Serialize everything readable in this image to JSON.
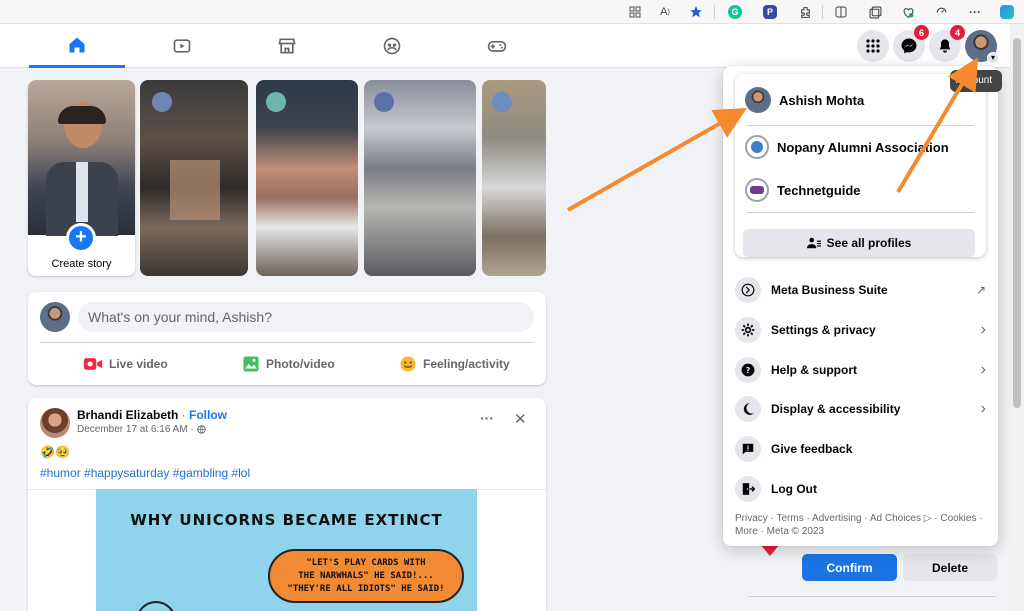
{
  "browser": {
    "icons": [
      "grid-icon",
      "read-aloud-icon",
      "favorite-star-icon",
      "grammarly-icon",
      "extension-p-icon",
      "extensions-puzzle-icon",
      "split-screen-icon",
      "collections-icon",
      "browser-essentials-icon",
      "performance-icon",
      "more-icon",
      "copilot-icon"
    ],
    "more_label": "···"
  },
  "nav": {
    "tabs": [
      "home-icon",
      "watch-icon",
      "marketplace-icon",
      "groups-icon",
      "gaming-icon"
    ],
    "messenger_badge": "6",
    "notifications_badge": "4",
    "tooltip": "Account"
  },
  "stories": {
    "create_label": "Create story",
    "plus": "+"
  },
  "composer": {
    "placeholder": "What's on your mind, Ashish?",
    "actions": [
      {
        "label": "Live video",
        "color": "#f02849"
      },
      {
        "label": "Photo/video",
        "color": "#45bd62"
      },
      {
        "label": "Feeling/activity",
        "color": "#f7b928"
      }
    ]
  },
  "post": {
    "author": "Brhandi Elizabeth",
    "separator": " · ",
    "follow": "Follow",
    "timestamp": "December 17 at 6:16 AM ·",
    "emoji": "🤣🥹",
    "hashtags": "#humor #happysaturday #gambling #lol",
    "more": "···",
    "close": "✕",
    "meme_title": "WHY UNICORNS BECAME EXTINCT",
    "meme_line1": "\"LET'S PLAY CARDS WITH",
    "meme_line2": "THE NARWHALS\" HE SAID!...",
    "meme_line3": "\"THEY'RE ALL IDIOTS\" HE SAID!"
  },
  "side": {
    "confirm": "Confirm",
    "delete": "Delete"
  },
  "menu": {
    "profiles": [
      {
        "name": "Ashish Mohta"
      },
      {
        "name": "Nopany Alumni Association"
      },
      {
        "name": "Technetguide"
      }
    ],
    "see_all": "See all profiles",
    "items": [
      {
        "label": "Meta Business Suite",
        "trail": "↗"
      },
      {
        "label": "Settings & privacy",
        "trail": "›"
      },
      {
        "label": "Help & support",
        "trail": "›"
      },
      {
        "label": "Display & accessibility",
        "trail": "›"
      },
      {
        "label": "Give feedback",
        "trail": ""
      },
      {
        "label": "Log Out",
        "trail": ""
      }
    ],
    "footer": "Privacy · Terms · Advertising · Ad Choices ▷ · Cookies · More · Meta © 2023"
  },
  "colors": {
    "accent": "#1877f2",
    "annotation_arrow": "#f58a2c",
    "badge": "#e41e3f"
  }
}
